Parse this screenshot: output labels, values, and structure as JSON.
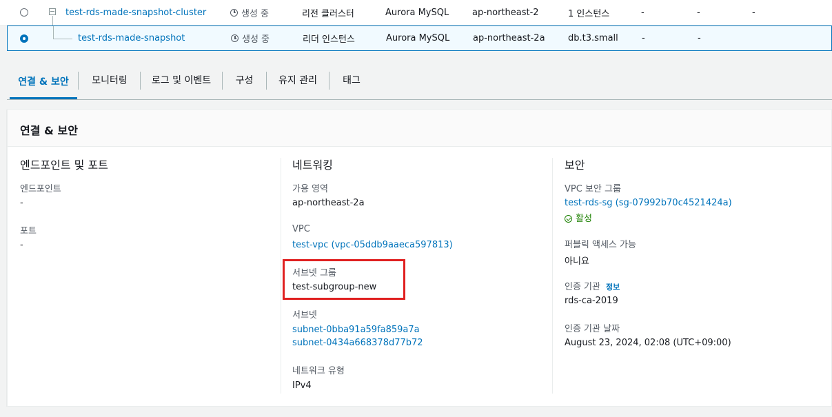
{
  "table": {
    "rows": [
      {
        "id": "test-rds-made-snapshot-cluster",
        "status": "생성 중",
        "role": "리전 클러스터",
        "engine": "Aurora MySQL",
        "region_az": "ap-northeast-2",
        "size": "1 인스턴스",
        "c1": "-",
        "c2": "-",
        "c3": "-",
        "selected": false
      },
      {
        "id": "test-rds-made-snapshot",
        "status": "생성 중",
        "role": "리더 인스턴스",
        "engine": "Aurora MySQL",
        "region_az": "ap-northeast-2a",
        "size": "db.t3.small",
        "c1": "-",
        "c2": "-",
        "selected": true
      }
    ]
  },
  "tabs": [
    "연결 & 보안",
    "모니터링",
    "로그 및 이벤트",
    "구성",
    "유지 관리",
    "태그"
  ],
  "panel": {
    "title": "연결 & 보안",
    "endpoints": {
      "title": "엔드포인트 및 포트",
      "endpoint_label": "엔드포인트",
      "endpoint_value": "-",
      "port_label": "포트",
      "port_value": "-"
    },
    "networking": {
      "title": "네트워킹",
      "az_label": "가용 영역",
      "az_value": "ap-northeast-2a",
      "vpc_label": "VPC",
      "vpc_value": "test-vpc (vpc-05ddb9aaeca597813)",
      "subnet_group_label": "서브넷 그룹",
      "subnet_group_value": "test-subgroup-new",
      "subnets_label": "서브넷",
      "subnets": [
        "subnet-0bba91a59fa859a7a",
        "subnet-0434a668378d77b72"
      ],
      "network_type_label": "네트워크 유형",
      "network_type_value": "IPv4"
    },
    "security": {
      "title": "보안",
      "vpc_sg_label": "VPC 보안 그룹",
      "vpc_sg_value": "test-rds-sg (sg-07992b70c4521424a)",
      "sg_status": "활성",
      "public_access_label": "퍼블릭 액세스 가능",
      "public_access_value": "아니요",
      "ca_label": "인증 기관",
      "ca_info": "정보",
      "ca_value": "rds-ca-2019",
      "ca_date_label": "인증 기관 날짜",
      "ca_date_value": "August 23, 2024, 02:08 (UTC+09:00)"
    }
  },
  "colors": {
    "link": "#0073bb",
    "success": "#1d8102",
    "highlight": "#e02020",
    "selected_row_bg": "#f1faff"
  },
  "icons": [
    "clock-icon",
    "check-circle-icon",
    "collapse-icon"
  ]
}
